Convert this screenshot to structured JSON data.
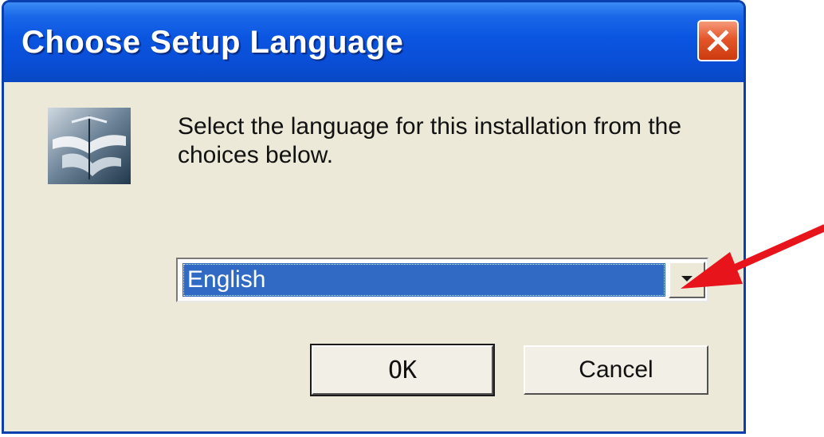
{
  "window": {
    "title": "Choose Setup Language",
    "close_icon": "close-icon"
  },
  "content": {
    "app_icon": "installer-sail-icon",
    "message": "Select the language for this installation from the choices below."
  },
  "language_select": {
    "selected": "English",
    "arrow_icon": "chevron-down-icon"
  },
  "buttons": {
    "ok_label": "OK",
    "cancel_label": "Cancel"
  },
  "annotation": {
    "pointer_icon": "red-arrow-icon",
    "color": "#e8141c"
  },
  "colors": {
    "titlebar": "#0a55e0",
    "dialog_bg": "#ece9d8",
    "selection": "#316ac5",
    "close_button": "#e4562a"
  }
}
